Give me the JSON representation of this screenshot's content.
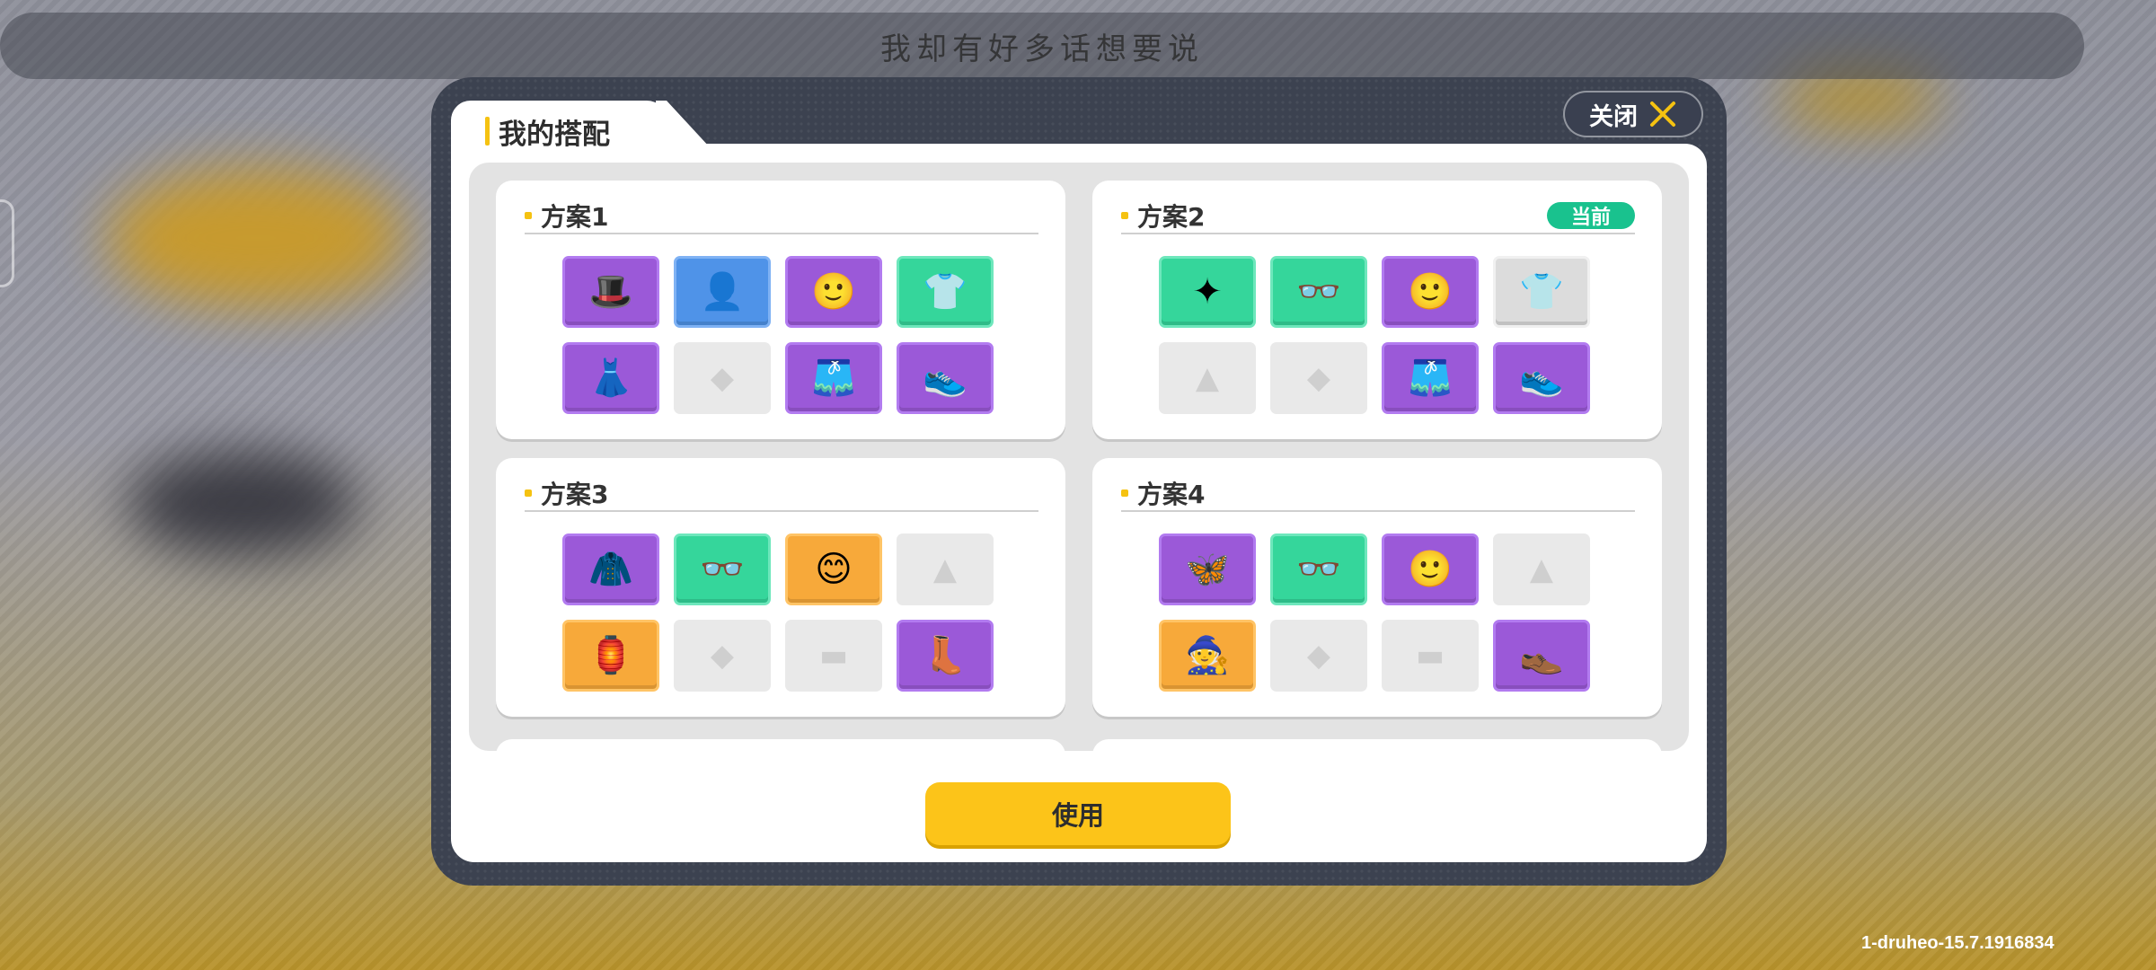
{
  "background": {
    "banner_text": "我却有好多话想要说",
    "version": "1-druheo-15.7.1916834"
  },
  "modal": {
    "title": "我的搭配",
    "close_label": "关闭",
    "use_label": "使用",
    "accent_color": "#f5c211",
    "current_badge": "当前",
    "plans": [
      {
        "name": "方案1",
        "current": false,
        "slots": [
          {
            "rarity": "purple",
            "icon": "hooded-cloud-hat-icon",
            "glyph": "🎩"
          },
          {
            "rarity": "blue",
            "icon": "gray-face-icon",
            "glyph": "👤"
          },
          {
            "rarity": "purple",
            "icon": "orange-face-icon",
            "glyph": "🙂"
          },
          {
            "rarity": "green",
            "icon": "black-shirt-icon",
            "glyph": "👕"
          },
          {
            "rarity": "purple",
            "icon": "white-skirt-icon",
            "glyph": "👗"
          },
          {
            "rarity": "empty",
            "icon": "empty-accessory-icon",
            "glyph": "◆"
          },
          {
            "rarity": "purple",
            "icon": "denim-shorts-icon",
            "glyph": "🩳"
          },
          {
            "rarity": "purple",
            "icon": "sneakers-icon",
            "glyph": "👟"
          }
        ]
      },
      {
        "name": "方案2",
        "current": true,
        "slots": [
          {
            "rarity": "green",
            "icon": "white-hair-icon",
            "glyph": "✦"
          },
          {
            "rarity": "green",
            "icon": "glasses-face-icon",
            "glyph": "👓"
          },
          {
            "rarity": "purple",
            "icon": "orange-face-icon",
            "glyph": "🙂"
          },
          {
            "rarity": "grayf",
            "icon": "white-shirt-icon",
            "glyph": "👕"
          },
          {
            "rarity": "empty",
            "icon": "empty-top-icon",
            "glyph": "▲"
          },
          {
            "rarity": "empty",
            "icon": "empty-accessory-icon",
            "glyph": "◆"
          },
          {
            "rarity": "purple",
            "icon": "denim-shorts-icon",
            "glyph": "🩳"
          },
          {
            "rarity": "purple",
            "icon": "sneakers-icon",
            "glyph": "👟"
          }
        ]
      },
      {
        "name": "方案3",
        "current": false,
        "slots": [
          {
            "rarity": "purple",
            "icon": "fluffy-jacket-icon",
            "glyph": "🧥"
          },
          {
            "rarity": "green",
            "icon": "glasses-face-icon",
            "glyph": "👓"
          },
          {
            "rarity": "orange",
            "icon": "blue-eyes-face-icon",
            "glyph": "😊"
          },
          {
            "rarity": "empty",
            "icon": "empty-top-icon",
            "glyph": "▲"
          },
          {
            "rarity": "orange",
            "icon": "lantern-prop-icon",
            "glyph": "🏮"
          },
          {
            "rarity": "empty",
            "icon": "empty-accessory-icon",
            "glyph": "◆"
          },
          {
            "rarity": "empty",
            "icon": "empty-bottom-icon",
            "glyph": "▬"
          },
          {
            "rarity": "purple",
            "icon": "fluffy-boots-icon",
            "glyph": "👢"
          }
        ]
      },
      {
        "name": "方案4",
        "current": false,
        "slots": [
          {
            "rarity": "purple",
            "icon": "crystal-wings-icon",
            "glyph": "🦋"
          },
          {
            "rarity": "green",
            "icon": "glasses-face-icon",
            "glyph": "👓"
          },
          {
            "rarity": "purple",
            "icon": "orange-face-icon",
            "glyph": "🙂"
          },
          {
            "rarity": "empty",
            "icon": "empty-top-icon",
            "glyph": "▲"
          },
          {
            "rarity": "orange",
            "icon": "wizard-robe-icon",
            "glyph": "🧙"
          },
          {
            "rarity": "empty",
            "icon": "empty-accessory-icon",
            "glyph": "◆"
          },
          {
            "rarity": "empty",
            "icon": "empty-bottom-icon",
            "glyph": "▬"
          },
          {
            "rarity": "purple",
            "icon": "gray-shoes-icon",
            "glyph": "👞"
          }
        ]
      }
    ]
  }
}
